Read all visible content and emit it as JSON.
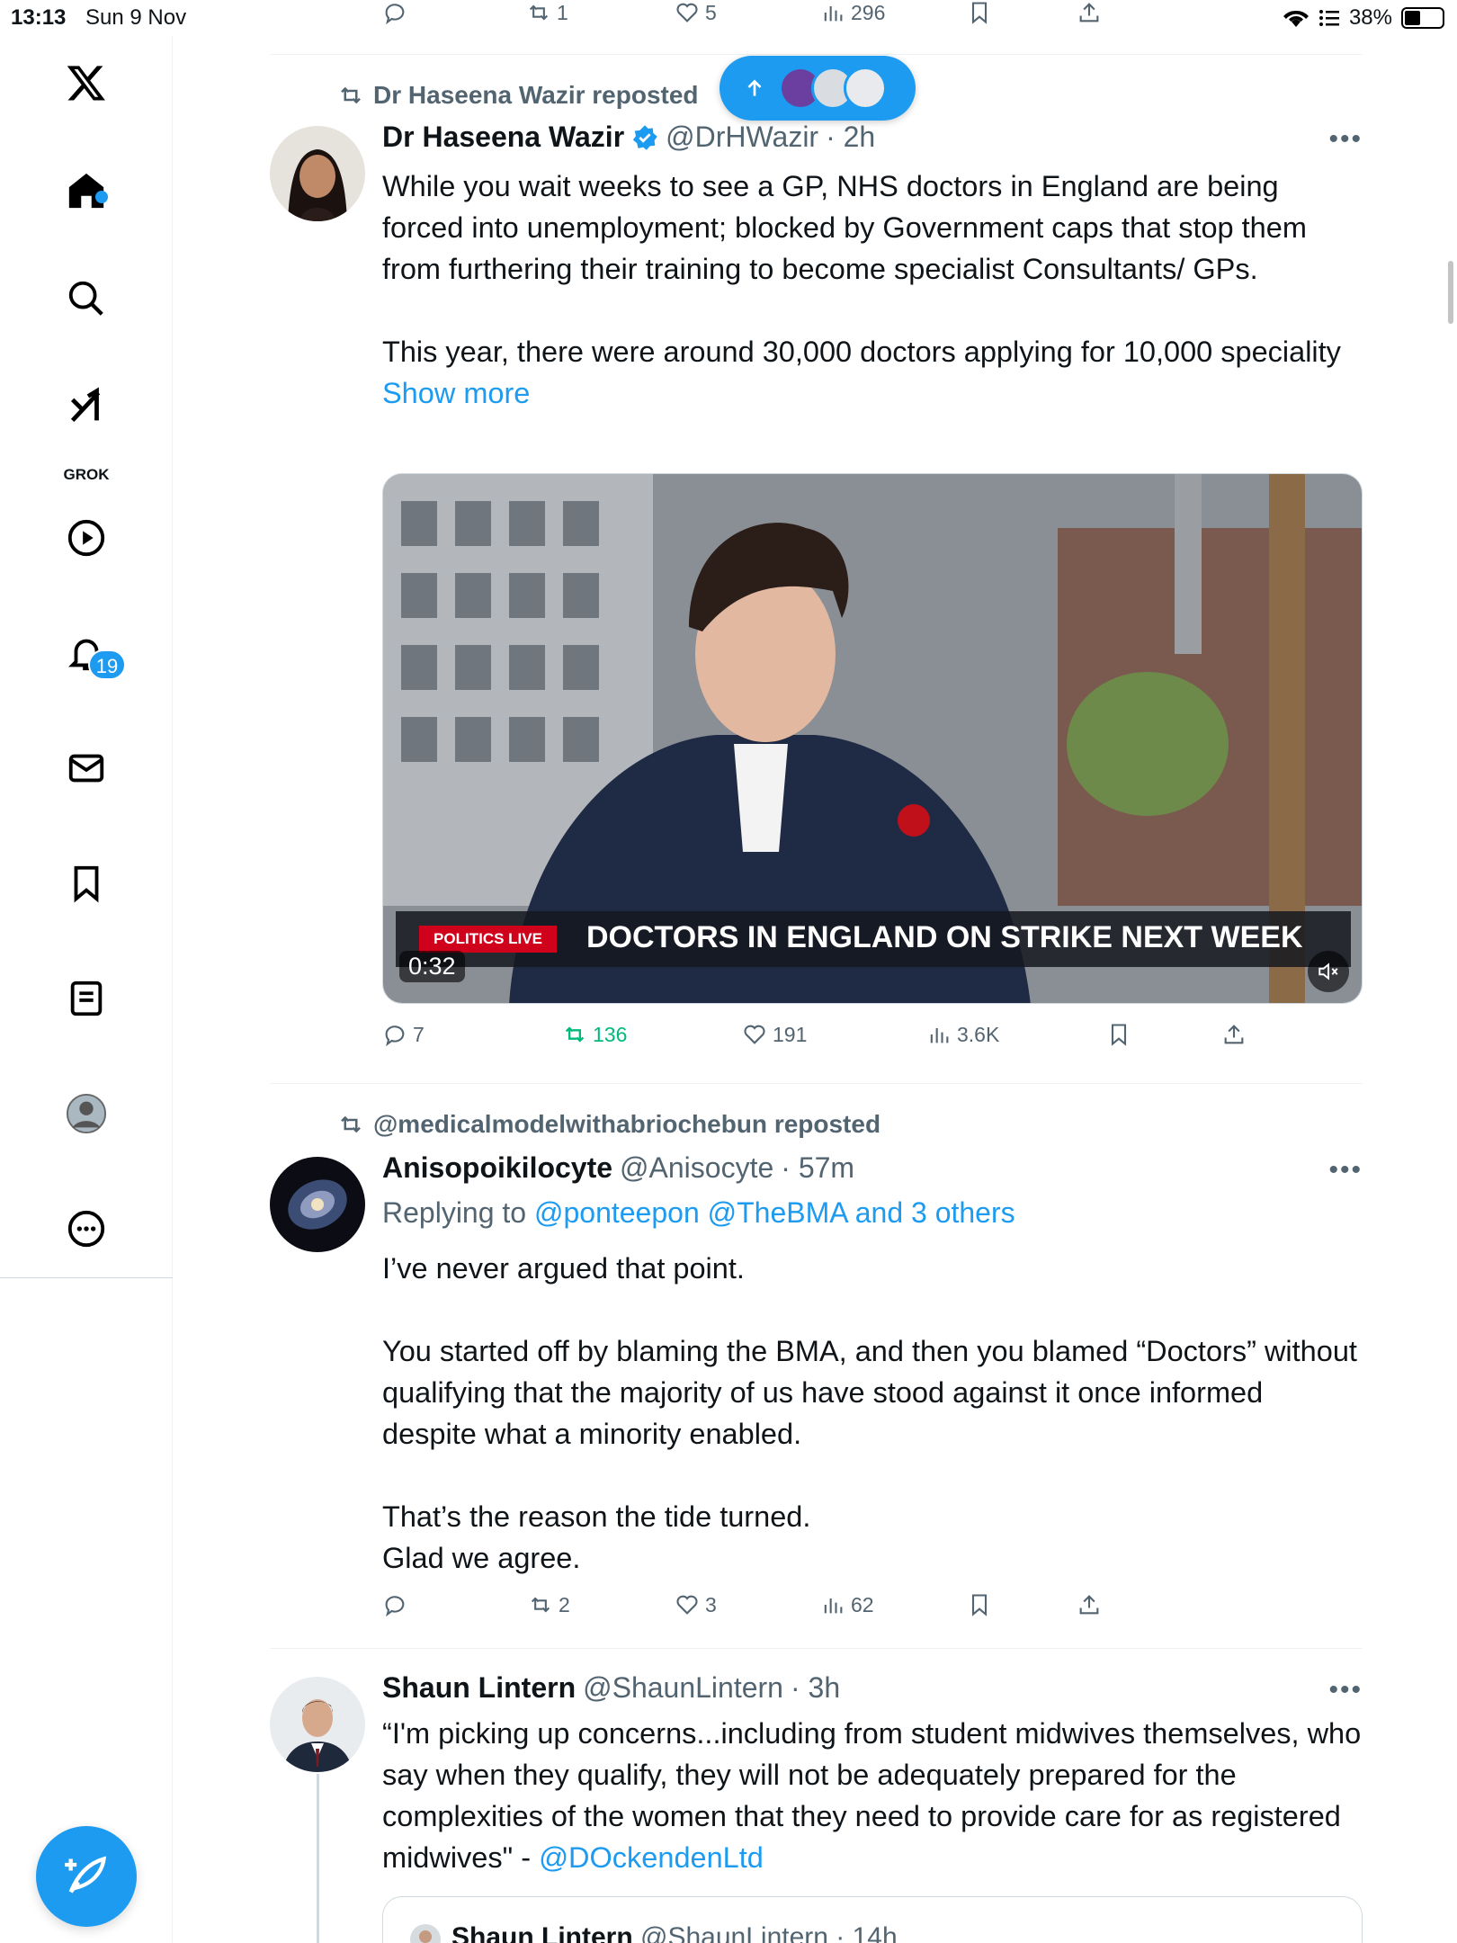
{
  "status_bar": {
    "time": "13:13",
    "date": "Sun 9 Nov",
    "battery": "38%"
  },
  "sidebar": {
    "notifications_badge": "19",
    "grok_label": "GROK",
    "items": [
      "x-logo",
      "home",
      "search",
      "grok",
      "video",
      "notifications",
      "messages",
      "bookmarks",
      "lists",
      "profile",
      "more"
    ]
  },
  "top_partial_tweet": {
    "retweets": "1",
    "likes": "5",
    "views": "296"
  },
  "new_posts_pill": {
    "icon": "arrow-up-icon"
  },
  "tweet1": {
    "repost_label": "Dr Haseena Wazir reposted",
    "name": "Dr Haseena Wazir",
    "handle": "@DrHWazir",
    "time": "· 2h",
    "text": "While you wait weeks to see a GP, NHS doctors in England are being forced into unemployment; blocked by Government caps that stop them from furthering their training to become specialist Consultants/ GPs.\n\nThis year, there were around 30,000 doctors applying for 10,000 speciality ",
    "show_more": "Show more",
    "video": {
      "tag": "POLITICS LIVE",
      "headline": "DOCTORS IN ENGLAND ON STRIKE NEXT WEEK",
      "duration": "0:32"
    },
    "replies": "7",
    "retweets": "136",
    "likes": "191",
    "views": "3.6K"
  },
  "tweet2": {
    "repost_label": "@medicalmodelwithabriochebun reposted",
    "name": "Anisopoikilocyte",
    "handle": "@Anisocyte",
    "time": "· 57m",
    "replying_prefix": "Replying to ",
    "replying_to": "@ponteepon @TheBMA and 3 others",
    "text": "I’ve never argued that point.\n\nYou started off by blaming the BMA, and then you blamed “Doctors” without qualifying that the majority of us have stood against it once informed despite what a minority enabled.\n\nThat’s the reason the tide turned.\nGlad we agree.",
    "retweets": "2",
    "likes": "3",
    "views": "62"
  },
  "tweet3": {
    "name": "Shaun Lintern",
    "handle": "@ShaunLintern",
    "time": "· 3h",
    "text": "“I'm picking up concerns...including from student midwives themselves, who say when they qualify, they will not be adequately prepared for the complexities of the women that they need to provide care for as registered midwives\" - ",
    "mention": "@DOckendenLtd",
    "quoted": {
      "name": "Shaun Lintern",
      "handle": "@ShaunLintern",
      "time": "· 14h"
    }
  },
  "colors": {
    "accent": "#1d9bf0",
    "retweet_green": "#00ba7c",
    "muted": "#536471"
  }
}
